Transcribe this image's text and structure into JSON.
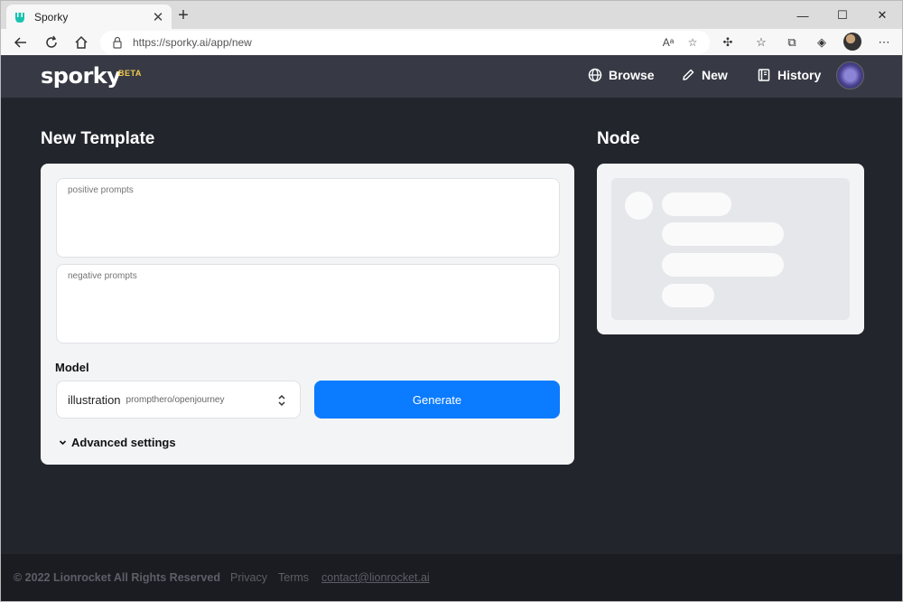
{
  "browser": {
    "tab_title": "Sporky",
    "url": "https://sporky.ai/app/new"
  },
  "header": {
    "logo": "sporky",
    "beta": "BETA",
    "nav": [
      {
        "label": "Browse",
        "icon": "globe-icon"
      },
      {
        "label": "New",
        "icon": "pencil-icon"
      },
      {
        "label": "History",
        "icon": "book-icon"
      }
    ]
  },
  "template": {
    "title": "New Template",
    "positive_placeholder": "positive prompts",
    "negative_placeholder": "negative prompts",
    "model_label": "Model",
    "model_name": "illustration",
    "model_path": "prompthero/openjourney",
    "generate_label": "Generate",
    "advanced_label": "Advanced settings"
  },
  "node": {
    "title": "Node"
  },
  "footer": {
    "copyright": "© 2022 Lionrocket All Rights Reserved",
    "privacy": "Privacy",
    "terms": "Terms",
    "contact": "contact@lionrocket.ai"
  },
  "colors": {
    "accent": "#0b7bff",
    "header_bg": "#373a45",
    "page_bg": "#23252d",
    "beta": "#f2c94c"
  }
}
